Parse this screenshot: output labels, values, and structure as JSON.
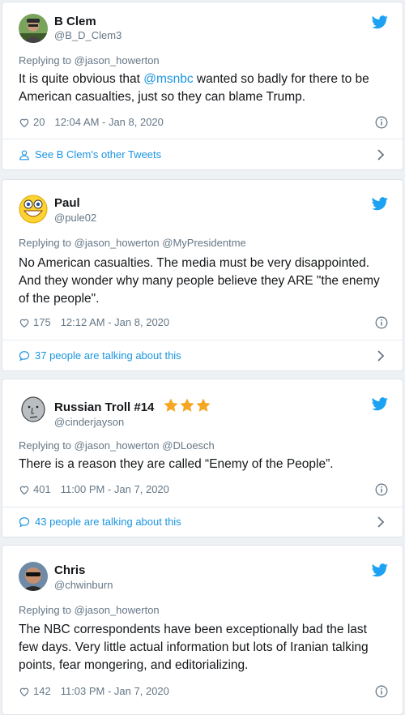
{
  "tweets": [
    {
      "name": "B Clem",
      "handle": "@B_D_Clem3",
      "replying_prefix": "Replying to",
      "replying_users": "@jason_howerton",
      "text_parts": [
        "It is quite obvious that ",
        "@msnbc",
        " wanted so badly for there to be American casualties, just so they can blame Trump."
      ],
      "likes": "20",
      "time": "12:04 AM - Jan 8, 2020",
      "footer": "See B Clem's other Tweets"
    },
    {
      "name": "Paul",
      "handle": "@pule02",
      "replying_prefix": "Replying to",
      "replying_users": "@jason_howerton @MyPresidentme",
      "text": "No American casualties. The media must be very disappointed. And they wonder why many people believe they ARE \"the enemy of the people\".",
      "likes": "175",
      "time": "12:12 AM - Jan 8, 2020",
      "footer": "37 people are talking about this"
    },
    {
      "name": "Russian Troll #14",
      "star_count": 3,
      "handle": "@cinderjayson",
      "replying_prefix": "Replying to",
      "replying_users": "@jason_howerton @DLoesch",
      "text": "There is a reason they are called “Enemy of the People”.",
      "likes": "401",
      "time": "11:00 PM - Jan 7, 2020",
      "footer": "43 people are talking about this"
    },
    {
      "name": "Chris",
      "handle": "@chwinburn",
      "replying_prefix": "Replying to",
      "replying_users": "@jason_howerton",
      "text": "The NBC correspondents have been exceptionally bad the last few days. Very little actual information but lots of Iranian talking points, fear mongering, and editorializing.",
      "likes": "142",
      "time": "11:03 PM - Jan 7, 2020"
    }
  ],
  "colors": {
    "link": "#1b95e0",
    "secondary_text": "#657786",
    "star": "#f5a623",
    "twitter_blue": "#1da1f2"
  }
}
